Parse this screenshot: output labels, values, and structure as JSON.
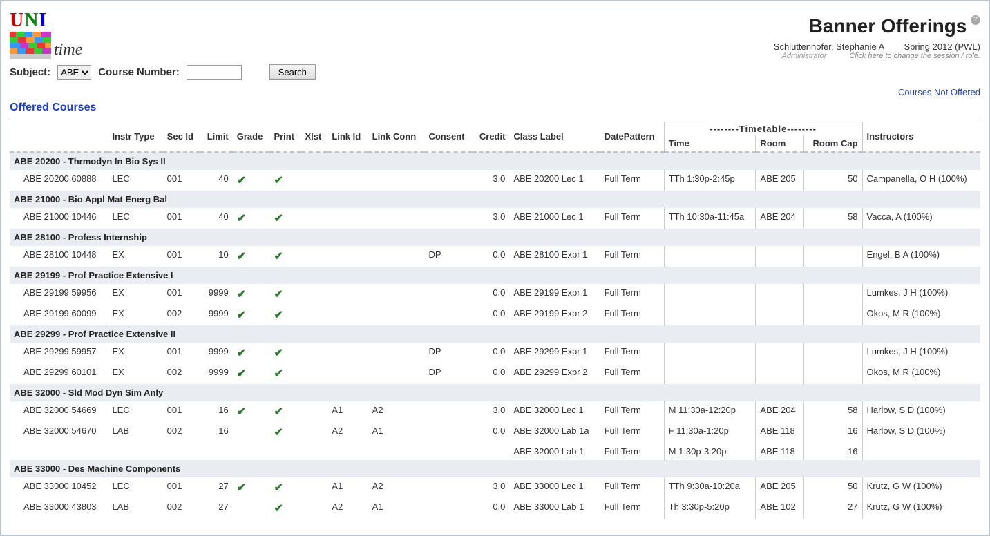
{
  "header": {
    "logo_uni": "UNI",
    "logo_time": "time",
    "page_title": "Banner Offerings",
    "user_line": "Schluttenhofer, Stephanie A",
    "session_line": "Spring 2012 (PWL)",
    "role": "Administrator",
    "change_hint": "Click here to change the session / role."
  },
  "filter": {
    "subject_label": "Subject:",
    "subject_value": "ABE",
    "course_label": "Course Number:",
    "course_value": "",
    "search_label": "Search"
  },
  "links": {
    "courses_not_offered": "Courses Not Offered"
  },
  "section_title": "Offered Courses",
  "columns": {
    "blank": "",
    "instr_type": "Instr Type",
    "sec_id": "Sec Id",
    "limit": "Limit",
    "grade": "Grade",
    "print": "Print",
    "xlst": "Xlst",
    "link_id": "Link Id",
    "link_conn": "Link Conn",
    "consent": "Consent",
    "credit": "Credit",
    "class_label": "Class Label",
    "date_pattern": "DatePattern",
    "timetable": "--------Timetable--------",
    "time": "Time",
    "room": "Room",
    "room_cap": "Room Cap",
    "instructors": "Instructors"
  },
  "courses": [
    {
      "title": "ABE 20200 - Thrmodyn In Bio Sys II",
      "rows": [
        {
          "name": "ABE 20200 60888",
          "instr_type": "LEC",
          "sec_id": "001",
          "limit": "40",
          "grade": true,
          "print": true,
          "xlst": "",
          "link_id": "",
          "link_conn": "",
          "consent": "",
          "credit": "3.0",
          "class_label": "ABE 20200 Lec 1",
          "date_pattern": "Full Term",
          "time": "TTh 1:30p-2:45p",
          "room": "ABE 205",
          "room_cap": "50",
          "instructors": "Campanella, O H (100%)",
          "indent": false
        }
      ]
    },
    {
      "title": "ABE 21000 - Bio Appl Mat Energ Bal",
      "rows": [
        {
          "name": "ABE 21000 10446",
          "instr_type": "LEC",
          "sec_id": "001",
          "limit": "40",
          "grade": true,
          "print": true,
          "xlst": "",
          "link_id": "",
          "link_conn": "",
          "consent": "",
          "credit": "3.0",
          "class_label": "ABE 21000 Lec 1",
          "date_pattern": "Full Term",
          "time": "TTh 10:30a-11:45a",
          "room": "ABE 204",
          "room_cap": "58",
          "instructors": "Vacca, A (100%)",
          "indent": false
        }
      ]
    },
    {
      "title": "ABE 28100 - Profess Internship",
      "rows": [
        {
          "name": "ABE 28100 10448",
          "instr_type": "EX",
          "sec_id": "001",
          "limit": "10",
          "grade": true,
          "print": true,
          "xlst": "",
          "link_id": "",
          "link_conn": "",
          "consent": "DP",
          "credit": "0.0",
          "class_label": "ABE 28100 Expr 1",
          "date_pattern": "Full Term",
          "time": "",
          "room": "",
          "room_cap": "",
          "instructors": "Engel, B A (100%)",
          "indent": false
        }
      ]
    },
    {
      "title": "ABE 29199 - Prof Practice Extensive I",
      "rows": [
        {
          "name": "ABE 29199 59956",
          "instr_type": "EX",
          "sec_id": "001",
          "limit": "9999",
          "grade": true,
          "print": true,
          "xlst": "",
          "link_id": "",
          "link_conn": "",
          "consent": "",
          "credit": "0.0",
          "class_label": "ABE 29199 Expr 1",
          "date_pattern": "Full Term",
          "time": "",
          "room": "",
          "room_cap": "",
          "instructors": "Lumkes, J H (100%)",
          "indent": false
        },
        {
          "name": "ABE 29199 60099",
          "instr_type": "EX",
          "sec_id": "002",
          "limit": "9999",
          "grade": true,
          "print": true,
          "xlst": "",
          "link_id": "",
          "link_conn": "",
          "consent": "",
          "credit": "0.0",
          "class_label": "ABE 29199 Expr 2",
          "date_pattern": "Full Term",
          "time": "",
          "room": "",
          "room_cap": "",
          "instructors": "Okos, M R (100%)",
          "indent": false
        }
      ]
    },
    {
      "title": "ABE 29299 - Prof Practice Extensive II",
      "rows": [
        {
          "name": "ABE 29299 59957",
          "instr_type": "EX",
          "sec_id": "001",
          "limit": "9999",
          "grade": true,
          "print": true,
          "xlst": "",
          "link_id": "",
          "link_conn": "",
          "consent": "DP",
          "credit": "0.0",
          "class_label": "ABE 29299 Expr 1",
          "date_pattern": "Full Term",
          "time": "",
          "room": "",
          "room_cap": "",
          "instructors": "Lumkes, J H (100%)",
          "indent": false
        },
        {
          "name": "ABE 29299 60101",
          "instr_type": "EX",
          "sec_id": "002",
          "limit": "9999",
          "grade": true,
          "print": true,
          "xlst": "",
          "link_id": "",
          "link_conn": "",
          "consent": "DP",
          "credit": "0.0",
          "class_label": "ABE 29299 Expr 2",
          "date_pattern": "Full Term",
          "time": "",
          "room": "",
          "room_cap": "",
          "instructors": "Okos, M R (100%)",
          "indent": false
        }
      ]
    },
    {
      "title": "ABE 32000 - Sld Mod Dyn Sim Anly",
      "rows": [
        {
          "name": "ABE 32000 54669",
          "instr_type": "LEC",
          "sec_id": "001",
          "limit": "16",
          "grade": true,
          "print": true,
          "xlst": "",
          "link_id": "A1",
          "link_conn": "A2",
          "consent": "",
          "credit": "3.0",
          "class_label": "ABE 32000 Lec 1",
          "date_pattern": "Full Term",
          "time": "M 11:30a-12:20p",
          "room": "ABE 204",
          "room_cap": "58",
          "instructors": "Harlow, S D (100%)",
          "indent": false
        },
        {
          "name": "ABE 32000 54670",
          "instr_type": "LAB",
          "sec_id": "002",
          "limit": "16",
          "grade": false,
          "print": true,
          "xlst": "",
          "link_id": "A2",
          "link_conn": "A1",
          "consent": "",
          "credit": "0.0",
          "class_label": "ABE 32000 Lab 1a",
          "date_pattern": "Full Term",
          "time": "F 11:30a-1:20p",
          "room": "ABE 118",
          "room_cap": "16",
          "instructors": "Harlow, S D (100%)",
          "indent": false
        },
        {
          "name": "",
          "instr_type": "",
          "sec_id": "",
          "limit": "",
          "grade": false,
          "print": false,
          "xlst": "",
          "link_id": "",
          "link_conn": "",
          "consent": "",
          "credit": "",
          "class_label": "ABE 32000 Lab 1",
          "date_pattern": "Full Term",
          "time": "M 1:30p-3:20p",
          "room": "ABE 118",
          "room_cap": "16",
          "instructors": "",
          "indent": true
        }
      ]
    },
    {
      "title": "ABE 33000 - Des Machine Components",
      "rows": [
        {
          "name": "ABE 33000 10452",
          "instr_type": "LEC",
          "sec_id": "001",
          "limit": "27",
          "grade": true,
          "print": true,
          "xlst": "",
          "link_id": "A1",
          "link_conn": "A2",
          "consent": "",
          "credit": "3.0",
          "class_label": "ABE 33000 Lec 1",
          "date_pattern": "Full Term",
          "time": "TTh 9:30a-10:20a",
          "room": "ABE 205",
          "room_cap": "50",
          "instructors": "Krutz, G W (100%)",
          "indent": false
        },
        {
          "name": "ABE 33000 43803",
          "instr_type": "LAB",
          "sec_id": "002",
          "limit": "27",
          "grade": false,
          "print": true,
          "xlst": "",
          "link_id": "A2",
          "link_conn": "A1",
          "consent": "",
          "credit": "0.0",
          "class_label": "ABE 33000 Lab 1",
          "date_pattern": "Full Term",
          "time": "Th 3:30p-5:20p",
          "room": "ABE 102",
          "room_cap": "27",
          "instructors": "Krutz, G W (100%)",
          "indent": false
        }
      ]
    }
  ]
}
